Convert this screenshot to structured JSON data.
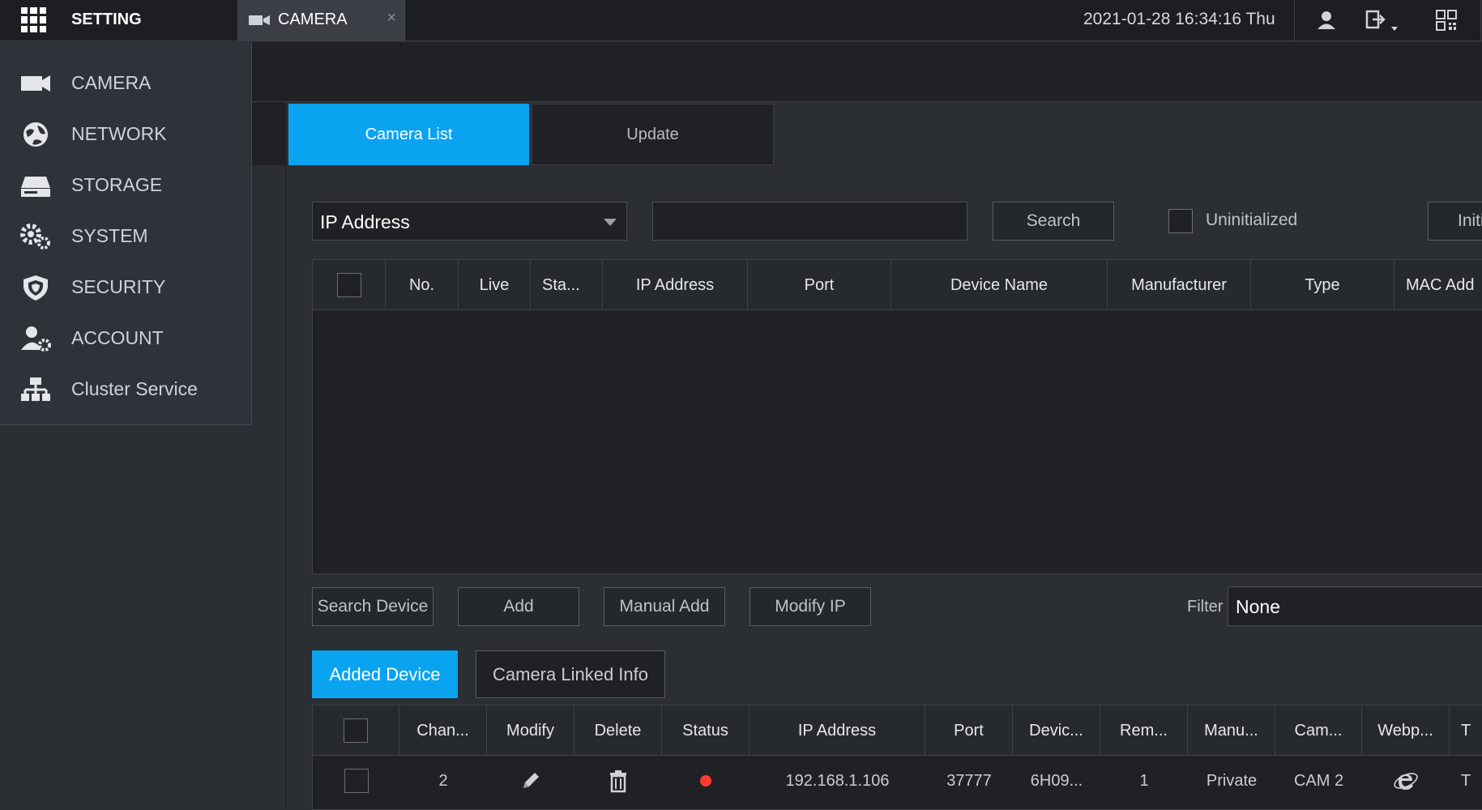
{
  "topbar": {
    "app_title": "SETTING",
    "tab_label": "CAMERA",
    "tab_close": "×",
    "datetime": "2021-01-28 16:34:16 Thu"
  },
  "sidebar": {
    "items": [
      {
        "label": "CAMERA",
        "icon": "camera-icon"
      },
      {
        "label": "NETWORK",
        "icon": "network-globe-icon"
      },
      {
        "label": "STORAGE",
        "icon": "hard-drive-icon"
      },
      {
        "label": "SYSTEM",
        "icon": "gears-icon"
      },
      {
        "label": "SECURITY",
        "icon": "shield-icon"
      },
      {
        "label": "ACCOUNT",
        "icon": "user-gear-icon"
      },
      {
        "label": "Cluster Service",
        "icon": "cluster-icon"
      }
    ]
  },
  "tabs": {
    "camera_list": "Camera List",
    "update": "Update"
  },
  "filter_row": {
    "field_select": "IP Address",
    "search_value": "",
    "search_button": "Search",
    "uninitialized_label": "Uninitialized",
    "initialize_button": "Initi"
  },
  "search_table": {
    "columns": [
      "No.",
      "Live",
      "Sta...",
      "IP Address",
      "Port",
      "Device Name",
      "Manufacturer",
      "Type",
      "MAC Add"
    ],
    "rows": []
  },
  "actions": {
    "search_device": "Search Device",
    "add": "Add",
    "manual_add": "Manual Add",
    "modify_ip": "Modify IP",
    "filter_label": "Filter",
    "filter_value": "None"
  },
  "device_tabs": {
    "added_device": "Added Device",
    "camera_linked_info": "Camera Linked Info"
  },
  "added_table": {
    "columns": [
      "Chan...",
      "Modify",
      "Delete",
      "Status",
      "IP Address",
      "Port",
      "Devic...",
      "Rem...",
      "Manu...",
      "Cam...",
      "Webp...",
      "T"
    ],
    "rows": [
      {
        "channel": "2",
        "status_color": "#ff3b30",
        "ip": "192.168.1.106",
        "port": "37777",
        "device": "6H09...",
        "remote": "1",
        "manufacturer": "Private",
        "camera": "CAM 2",
        "webpage_icon": "ie-browser-icon",
        "type": "T"
      }
    ]
  },
  "colors": {
    "accent": "#0aa3f0",
    "status_offline": "#ff3b30"
  }
}
